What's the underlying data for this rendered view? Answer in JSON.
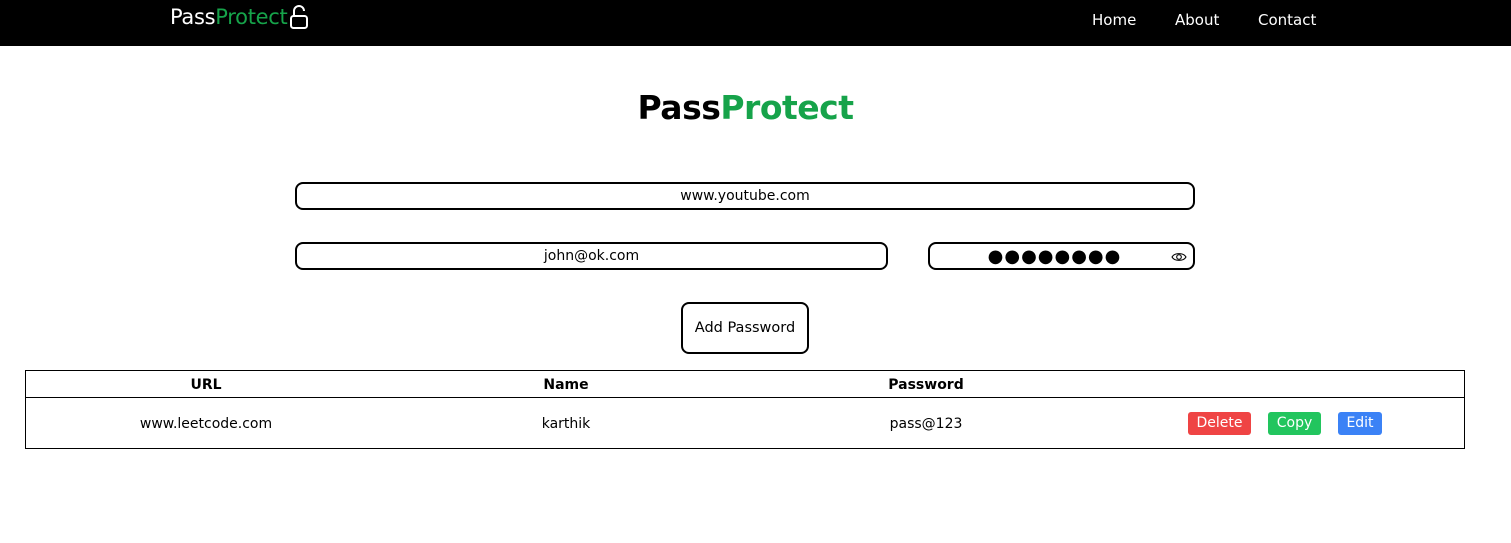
{
  "nav": {
    "logo_pass": "Pass",
    "logo_protect": "Protect",
    "links": {
      "home": "Home",
      "about": "About",
      "contact": "Contact"
    }
  },
  "title": {
    "pass": "Pass",
    "protect": "Protect"
  },
  "form": {
    "url_value": "www.youtube.com",
    "username_value": "john@ok.com",
    "password_masked": "●●●●●●●●",
    "add_button_label": "Add Password"
  },
  "table": {
    "headers": {
      "url": "URL",
      "name": "Name",
      "password": "Password"
    },
    "rows": [
      {
        "url": "www.leetcode.com",
        "name": "karthik",
        "password": "pass@123",
        "actions": {
          "delete": "Delete",
          "copy": "Copy",
          "edit": "Edit"
        }
      }
    ]
  },
  "colors": {
    "accent_green": "#16a34a",
    "delete_red": "#ef4444",
    "copy_green": "#22c55e",
    "edit_blue": "#3b82f6",
    "navbar_bg": "#000000"
  },
  "icons": {
    "logo": "lock-icon",
    "password_toggle": "eye-icon"
  }
}
